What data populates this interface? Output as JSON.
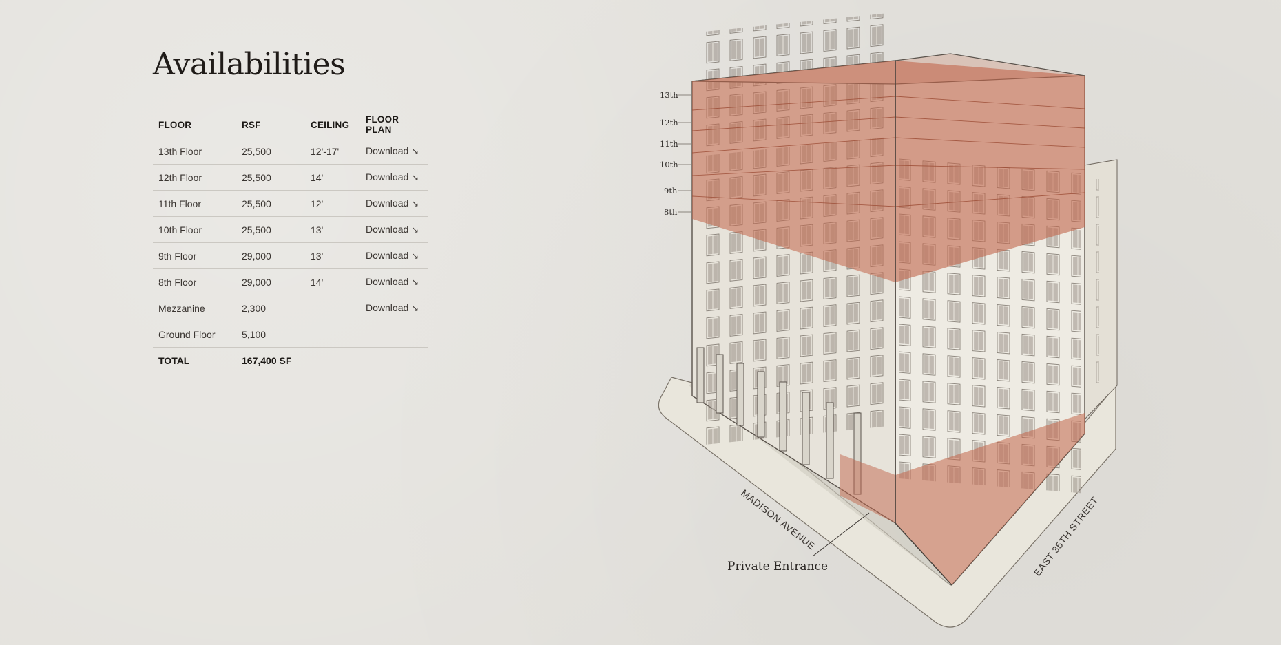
{
  "page": {
    "title": "Availabilities"
  },
  "table": {
    "headers": {
      "floor": "FLOOR",
      "rsf": "RSF",
      "ceiling": "CEILING",
      "floor_plan": "FLOOR PLAN"
    },
    "rows": [
      {
        "floor": "13th Floor",
        "rsf": "25,500",
        "ceiling": "12'-17'",
        "plan": "Download",
        "plan_icon": "arrow-down-right-icon"
      },
      {
        "floor": "12th Floor",
        "rsf": "25,500",
        "ceiling": "14'",
        "plan": "Download",
        "plan_icon": "arrow-down-right-icon"
      },
      {
        "floor": "11th Floor",
        "rsf": "25,500",
        "ceiling": "12'",
        "plan": "Download",
        "plan_icon": "arrow-down-right-icon"
      },
      {
        "floor": "10th Floor",
        "rsf": "25,500",
        "ceiling": "13'",
        "plan": "Download",
        "plan_icon": "arrow-down-right-icon"
      },
      {
        "floor": "9th Floor",
        "rsf": "29,000",
        "ceiling": "13'",
        "plan": "Download",
        "plan_icon": "arrow-down-right-icon"
      },
      {
        "floor": "8th Floor",
        "rsf": "29,000",
        "ceiling": "14'",
        "plan": "Download",
        "plan_icon": "arrow-down-right-icon"
      },
      {
        "floor": "Mezzanine",
        "rsf": "2,300",
        "ceiling": "",
        "plan": "Download",
        "plan_icon": "arrow-down-right-icon"
      },
      {
        "floor": "Ground Floor",
        "rsf": "5,100",
        "ceiling": "",
        "plan": "",
        "plan_icon": ""
      }
    ],
    "total": {
      "label": "TOTAL",
      "value": "167,400 SF"
    }
  },
  "illustration": {
    "floor_labels": [
      "13th",
      "12th",
      "11th",
      "10th",
      "9th",
      "8th"
    ],
    "street_labels": {
      "madison": "MADISON AVENUE",
      "east35": "EAST 35TH STREET"
    },
    "entrance_label": "Private Entrance",
    "colors": {
      "highlight": "#c2664b",
      "facade": "#ebe7de",
      "shadow": "#d5d1c6",
      "line": "#5a534c",
      "sidewalk": "#e9e6dc"
    }
  }
}
